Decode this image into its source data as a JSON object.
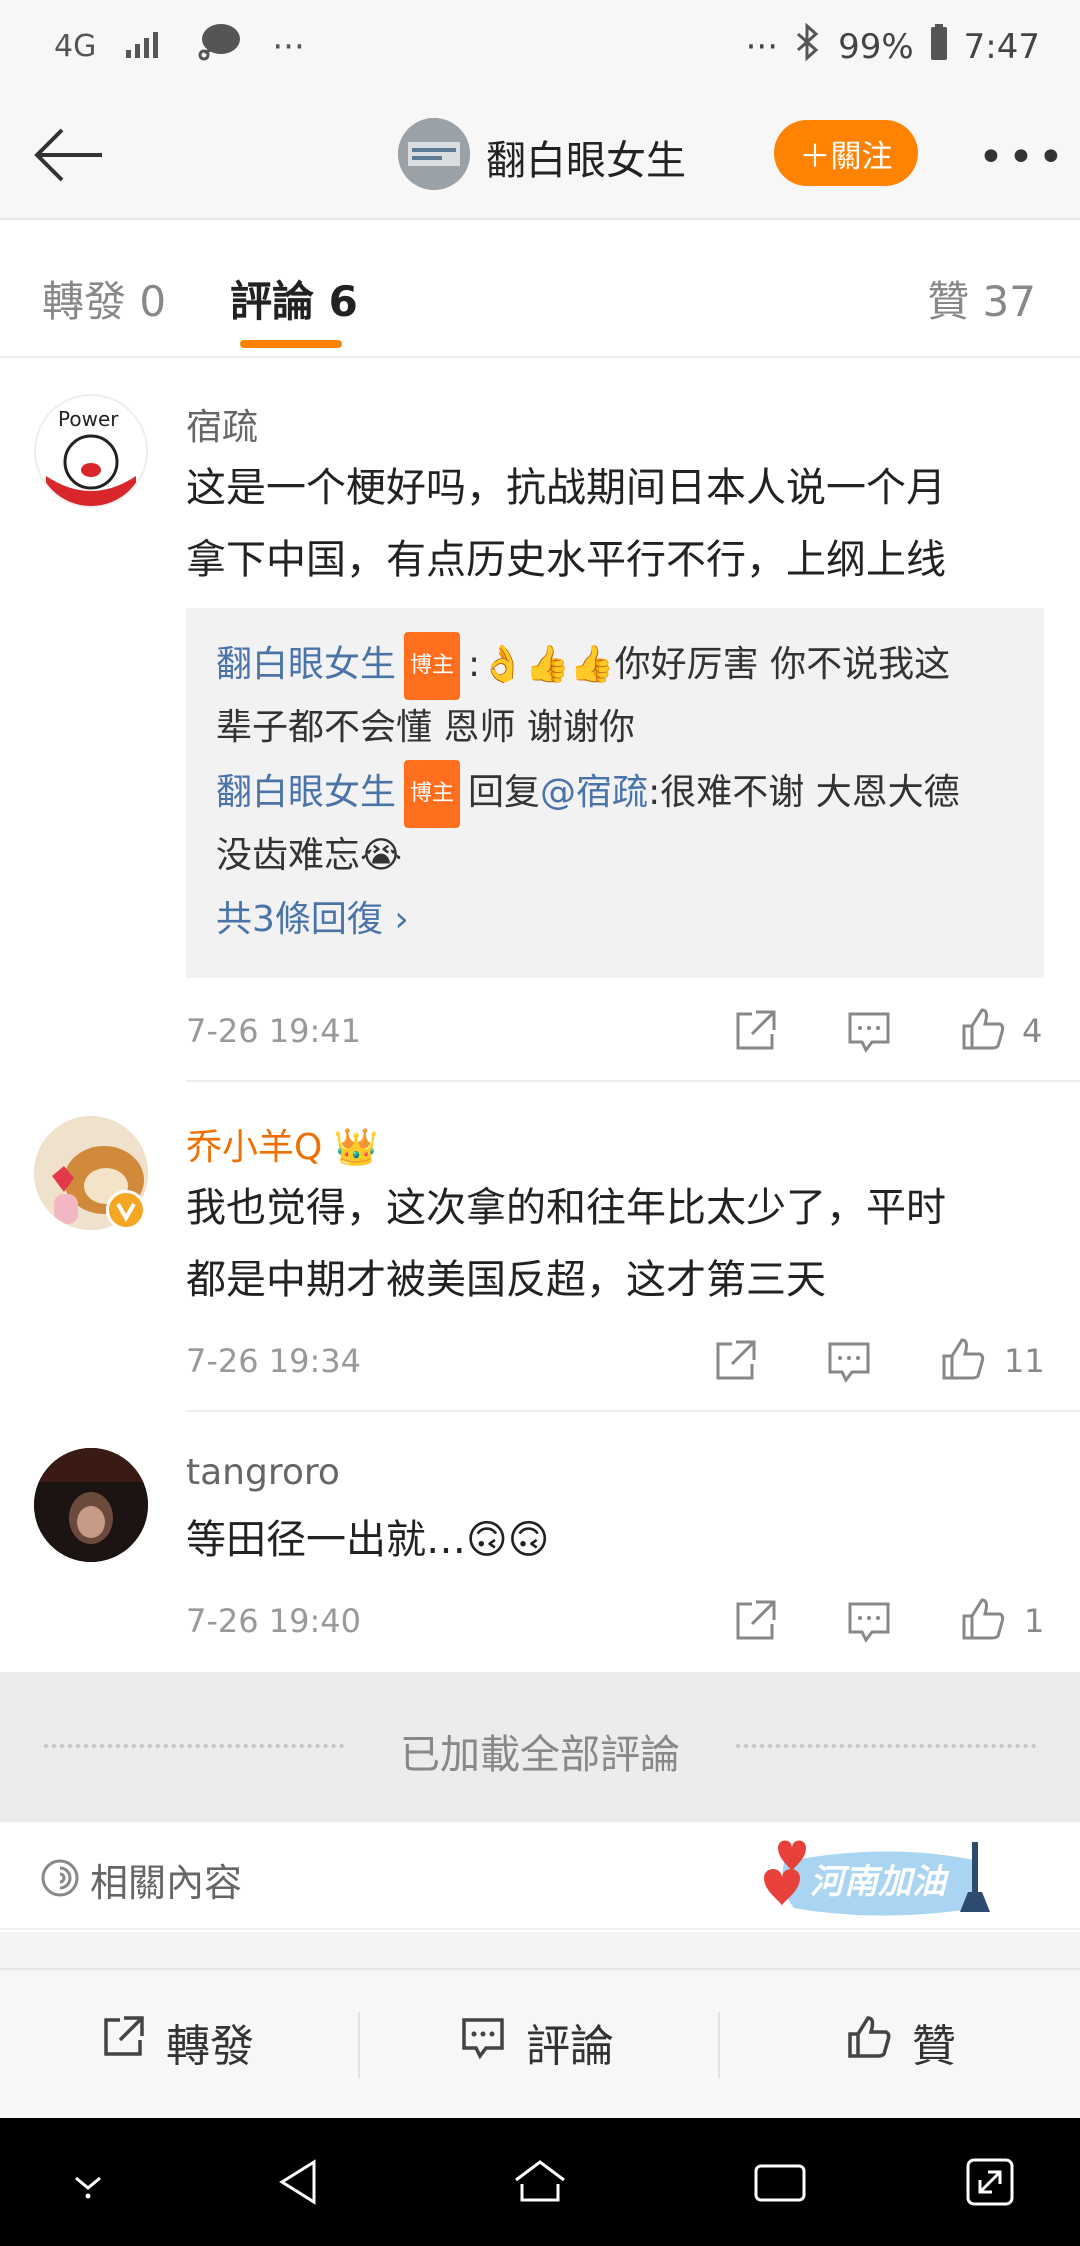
{
  "status_bar": {
    "network": "4G",
    "more_left": "···",
    "more_right": "···",
    "battery": "99%",
    "time": "7:47"
  },
  "header": {
    "title": "翻白眼女生",
    "follow_label": "＋關注",
    "more": "•••"
  },
  "tabs": {
    "repost": "轉發 0",
    "comments": "評論 6",
    "likes": "贊 37"
  },
  "comments": [
    {
      "user": "宿疏",
      "text_line1": "这是一个梗好吗，抗战期间日本人说一个月",
      "text_line2": "拿下中国，有点历史水平行不行，上纲上线",
      "replies": {
        "r1_name": "翻白眼女生",
        "r1_badge": "博主",
        "r1_text": ":👌👍👍你好厉害 你不说我这",
        "r1_text2": "辈子都不会懂 恩师 谢谢你",
        "r2_name": "翻白眼女生",
        "r2_badge": "博主",
        "r2_prefix": "回复",
        "r2_mention": "@宿疏",
        "r2_text": ":很难不谢 大恩大德",
        "r2_text2": "没齿难忘😭",
        "more": "共3條回復 ›"
      },
      "time": "7-26 19:41",
      "likes": "4"
    },
    {
      "user": "乔小羊Q",
      "user_badge": "👑",
      "text_line1": "我也觉得，这次拿的和往年比太少了，平时",
      "text_line2": "都是中期才被美国反超，这才第三天",
      "time": "7-26 19:34",
      "likes": "11"
    },
    {
      "user": "tangroro",
      "text_line1": "等田径一出就…🙃🙃",
      "time": "7-26 19:40",
      "likes": "1"
    }
  ],
  "loaded_all": "已加載全部評論",
  "related": {
    "label": "相關內容",
    "banner_text": "河南加油"
  },
  "bottom_bar": {
    "repost": "轉發",
    "comment": "評論",
    "like": "贊"
  },
  "colors": {
    "accent": "#ff8200",
    "link": "#4a74a8",
    "badge": "#ff6f1e",
    "vip_name": "#f06f00"
  }
}
